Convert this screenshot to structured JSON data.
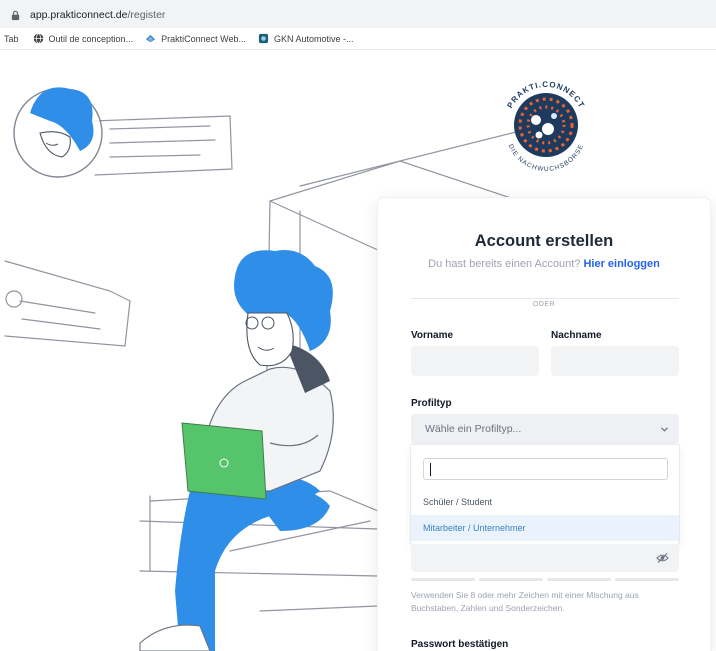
{
  "browser": {
    "url_host": "app.prakticonnect.de",
    "url_path": "/register"
  },
  "bookmarks": [
    {
      "label": "Tab",
      "icon": "none"
    },
    {
      "label": "Outil de conception...",
      "icon": "globe-icon"
    },
    {
      "label": "PraktiConnect Web...",
      "icon": "prakticonnect-icon"
    },
    {
      "label": "GKN Automotive -...",
      "icon": "gkn-icon"
    }
  ],
  "logo": {
    "brand_top": "PRAKTI.CONNECT",
    "brand_bottom": "DIE NACHWUCHSBÖRSE"
  },
  "form": {
    "title": "Account erstellen",
    "subtitle_prefix": "Du hast bereits einen Account?",
    "login_link": "Hier einloggen",
    "divider": "ODER",
    "vorname_label": "Vorname",
    "nachname_label": "Nachname",
    "profiltyp_label": "Profiltyp",
    "profiltyp_placeholder": "Wähle ein Profiltyp...",
    "dropdown_options": [
      "Schüler / Student",
      "Mitarbeiter / Unternehmer"
    ],
    "password_hint": "Verwenden Sie 8 oder mehr Zeichen mit einer Mischung aus Buchstaben, Zahlen und Sonderzeichen.",
    "confirm_label": "Passwort bestätigen"
  },
  "colors": {
    "accent_blue": "#2563eb",
    "illustration_blue": "#2f8ee8",
    "laptop_green": "#55c46a",
    "logo_navy": "#1e3a5f",
    "logo_orange": "#e8652d"
  }
}
